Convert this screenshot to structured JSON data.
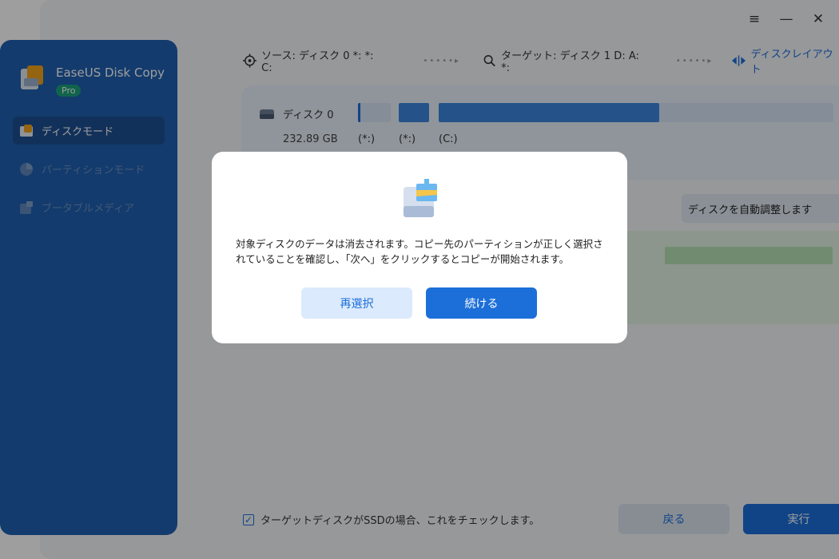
{
  "app": {
    "name": "EaseUS Disk Copy",
    "badge": "Pro"
  },
  "window_controls": {
    "menu": "≡",
    "minimize": "—",
    "close": "✕"
  },
  "sidebar": {
    "items": [
      {
        "label": "ディスクモード",
        "active": true
      },
      {
        "label": "パーティションモード",
        "active": false
      },
      {
        "label": "ブータブルメディア",
        "active": false
      }
    ]
  },
  "topbar": {
    "source": "ソース: ディスク 0 *: *: C:",
    "target": "ターゲット: ディスク 1 D: A: *:",
    "layout_link": "ディスクレイアウト"
  },
  "disk": {
    "name": "ディスク 0",
    "size": "232.89 GB",
    "partitions": [
      "(*:)",
      "(*:)",
      "(C:)"
    ]
  },
  "auto_adjust": {
    "selected": "ディスクを自動調整します"
  },
  "footer": {
    "ssd_check_label": "ターゲットディスクがSSDの場合、これをチェックします。",
    "ssd_checked": true,
    "back_label": "戻る",
    "run_label": "実行"
  },
  "modal": {
    "message": "対象ディスクのデータは消去されます。コピー先のパーティションが正しく選択されていることを確認し、「次へ」をクリックするとコピーが開始されます。",
    "reselect_label": "再選択",
    "continue_label": "続ける"
  },
  "colors": {
    "accent": "#1c6fd8",
    "sidebar": "#1f5fb0",
    "pro_badge": "#1aa27a",
    "target_panel": "#e3f2e3"
  }
}
